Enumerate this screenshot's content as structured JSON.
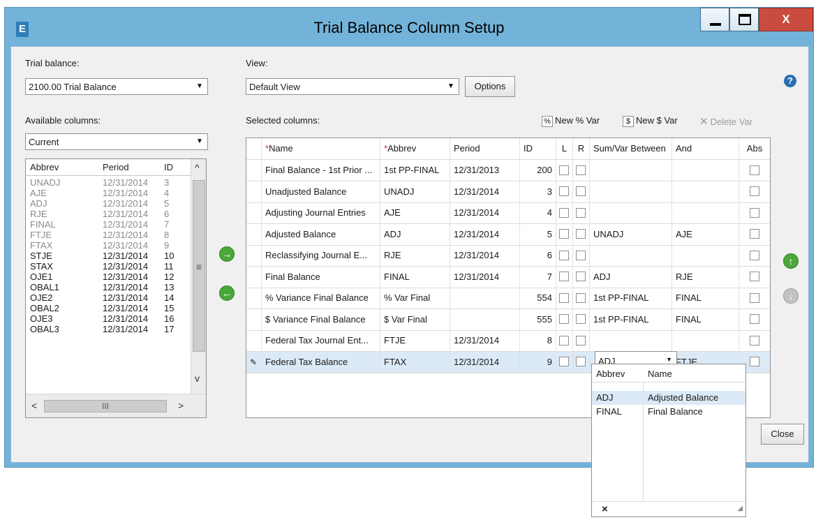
{
  "window": {
    "title": "Trial Balance Column Setup",
    "app_icon_letter": "E",
    "close_glyph": "X"
  },
  "trial_balance": {
    "label": "Trial balance:",
    "value": "2100.00 Trial Balance"
  },
  "view": {
    "label": "View:",
    "value": "Default View",
    "options_button": "Options"
  },
  "available": {
    "label": "Available columns:",
    "filter_value": "Current",
    "headers": [
      "Abbrev",
      "Period",
      "ID"
    ],
    "rows": [
      {
        "abbrev": "UNADJ",
        "period": "12/31/2014",
        "id": "3",
        "dim": true
      },
      {
        "abbrev": "AJE",
        "period": "12/31/2014",
        "id": "4",
        "dim": true
      },
      {
        "abbrev": "ADJ",
        "period": "12/31/2014",
        "id": "5",
        "dim": true
      },
      {
        "abbrev": "RJE",
        "period": "12/31/2014",
        "id": "6",
        "dim": true
      },
      {
        "abbrev": "FINAL",
        "period": "12/31/2014",
        "id": "7",
        "dim": true
      },
      {
        "abbrev": "FTJE",
        "period": "12/31/2014",
        "id": "8",
        "dim": true
      },
      {
        "abbrev": "FTAX",
        "period": "12/31/2014",
        "id": "9",
        "dim": true
      },
      {
        "abbrev": "STJE",
        "period": "12/31/2014",
        "id": "10",
        "dim": false
      },
      {
        "abbrev": "STAX",
        "period": "12/31/2014",
        "id": "11",
        "dim": false
      },
      {
        "abbrev": "OJE1",
        "period": "12/31/2014",
        "id": "12",
        "dim": false
      },
      {
        "abbrev": "OBAL1",
        "period": "12/31/2014",
        "id": "13",
        "dim": false
      },
      {
        "abbrev": "OJE2",
        "period": "12/31/2014",
        "id": "14",
        "dim": false
      },
      {
        "abbrev": "OBAL2",
        "period": "12/31/2014",
        "id": "15",
        "dim": false
      },
      {
        "abbrev": "OJE3",
        "period": "12/31/2014",
        "id": "16",
        "dim": false
      },
      {
        "abbrev": "OBAL3",
        "period": "12/31/2014",
        "id": "17",
        "dim": false
      }
    ]
  },
  "selected": {
    "label": "Selected columns:",
    "toolbar": {
      "new_pct_var": "New % Var",
      "new_dollar_var": "New $ Var",
      "delete_var": "Delete Var"
    },
    "headers": {
      "name": "Name",
      "abbrev": "Abbrev",
      "period": "Period",
      "id": "ID",
      "l": "L",
      "r": "R",
      "sumvar": "Sum/Var Between",
      "and": "And",
      "abs": "Abs"
    },
    "rows": [
      {
        "name": "Final Balance - 1st Prior ...",
        "abbrev": "1st PP-FINAL",
        "period": "12/31/2013",
        "id": "200",
        "sumvar": "",
        "and": ""
      },
      {
        "name": "Unadjusted Balance",
        "abbrev": "UNADJ",
        "period": "12/31/2014",
        "id": "3",
        "sumvar": "",
        "and": ""
      },
      {
        "name": "Adjusting Journal Entries",
        "abbrev": "AJE",
        "period": "12/31/2014",
        "id": "4",
        "sumvar": "",
        "and": ""
      },
      {
        "name": "Adjusted Balance",
        "abbrev": "ADJ",
        "period": "12/31/2014",
        "id": "5",
        "sumvar": "UNADJ",
        "and": "AJE"
      },
      {
        "name": "Reclassifying Journal E...",
        "abbrev": "RJE",
        "period": "12/31/2014",
        "id": "6",
        "sumvar": "",
        "and": ""
      },
      {
        "name": "Final Balance",
        "abbrev": "FINAL",
        "period": "12/31/2014",
        "id": "7",
        "sumvar": "ADJ",
        "and": "RJE"
      },
      {
        "name": "% Variance Final Balance",
        "abbrev": "% Var Final",
        "period": "",
        "id": "554",
        "sumvar": "1st PP-FINAL",
        "and": "FINAL"
      },
      {
        "name": "$ Variance Final Balance",
        "abbrev": "$ Var Final",
        "period": "",
        "id": "555",
        "sumvar": "1st PP-FINAL",
        "and": "FINAL"
      },
      {
        "name": "Federal Tax Journal Ent...",
        "abbrev": "FTJE",
        "period": "12/31/2014",
        "id": "8",
        "sumvar": "",
        "and": ""
      },
      {
        "name": "Federal Tax Balance",
        "abbrev": "FTAX",
        "period": "12/31/2014",
        "id": "9",
        "sumvar": "ADJ",
        "and": "FTJE"
      }
    ]
  },
  "dropdown": {
    "headers": [
      "Abbrev",
      "Name"
    ],
    "rows": [
      {
        "abbrev": "ADJ",
        "name": "Adjusted Balance"
      },
      {
        "abbrev": "FINAL",
        "name": "Final Balance"
      }
    ],
    "clear_glyph": "×"
  },
  "close_button": "Close",
  "colors": {
    "titlebar": "#73b3da",
    "close": "#c94c3f",
    "green": "#4aa83a"
  }
}
